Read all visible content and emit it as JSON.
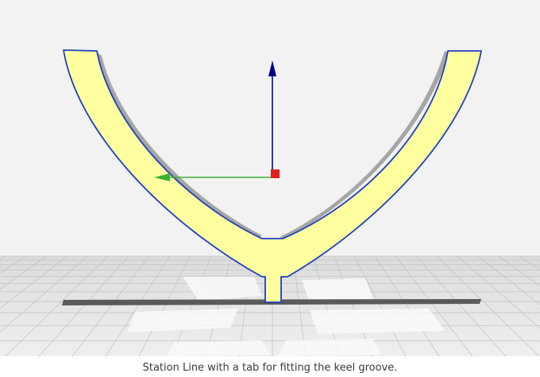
{
  "caption": "Station Line with a tab for fitting the keel groove.",
  "scene": {
    "background_color": "#f2f2f2",
    "floor_color": "#e9e9e9",
    "grid_color": "#c8c8c8",
    "model_fill": "#ffff9f",
    "model_outline": "#1f3fbf",
    "model_side": "#a8a8a8",
    "shadow_color": "#5a5a5a",
    "axes": {
      "up_arrow": {
        "color": "#00008b",
        "icon": "arrow-up-icon"
      },
      "left_arrow": {
        "color": "#3cb034",
        "icon": "arrow-left-icon"
      },
      "origin": {
        "color": "#e0201f",
        "icon": "square-handle-icon"
      }
    }
  }
}
